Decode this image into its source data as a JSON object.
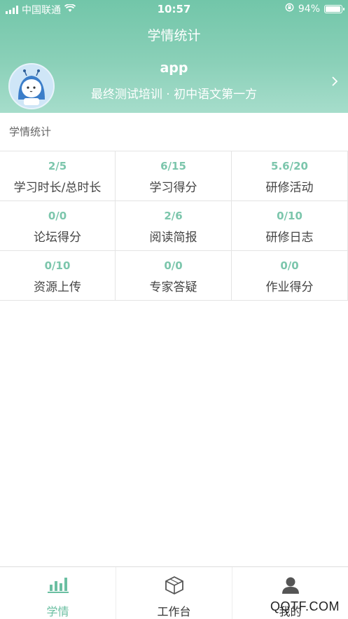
{
  "status_bar": {
    "carrier": "中国联通",
    "time": "10:57",
    "battery": "94%",
    "battery_level": 0.94
  },
  "nav": {
    "title": "学情统计"
  },
  "profile": {
    "name": "app",
    "subtitle": "最终测试培训 · 初中语文第一方"
  },
  "section": {
    "title": "学情统计"
  },
  "stats": [
    {
      "value": "2/5",
      "label": "学习时长/总时长"
    },
    {
      "value": "6/15",
      "label": "学习得分"
    },
    {
      "value": "5.6/20",
      "label": "研修活动"
    },
    {
      "value": "0/0",
      "label": "论坛得分"
    },
    {
      "value": "2/6",
      "label": "阅读简报"
    },
    {
      "value": "0/10",
      "label": "研修日志"
    },
    {
      "value": "0/10",
      "label": "资源上传"
    },
    {
      "value": "0/0",
      "label": "专家答疑"
    },
    {
      "value": "0/0",
      "label": "作业得分"
    }
  ],
  "tabbar": {
    "items": [
      {
        "label": "学情",
        "icon": "bar-chart-icon",
        "active": true
      },
      {
        "label": "工作台",
        "icon": "cube-icon",
        "active": false
      },
      {
        "label": "我的",
        "icon": "person-icon",
        "active": false
      }
    ]
  },
  "watermark": {
    "text": "QQTF.COM"
  },
  "colors": {
    "accent": "#72c6a9",
    "value_text": "#7cc6ac",
    "active_tab": "#6bbfa2"
  }
}
